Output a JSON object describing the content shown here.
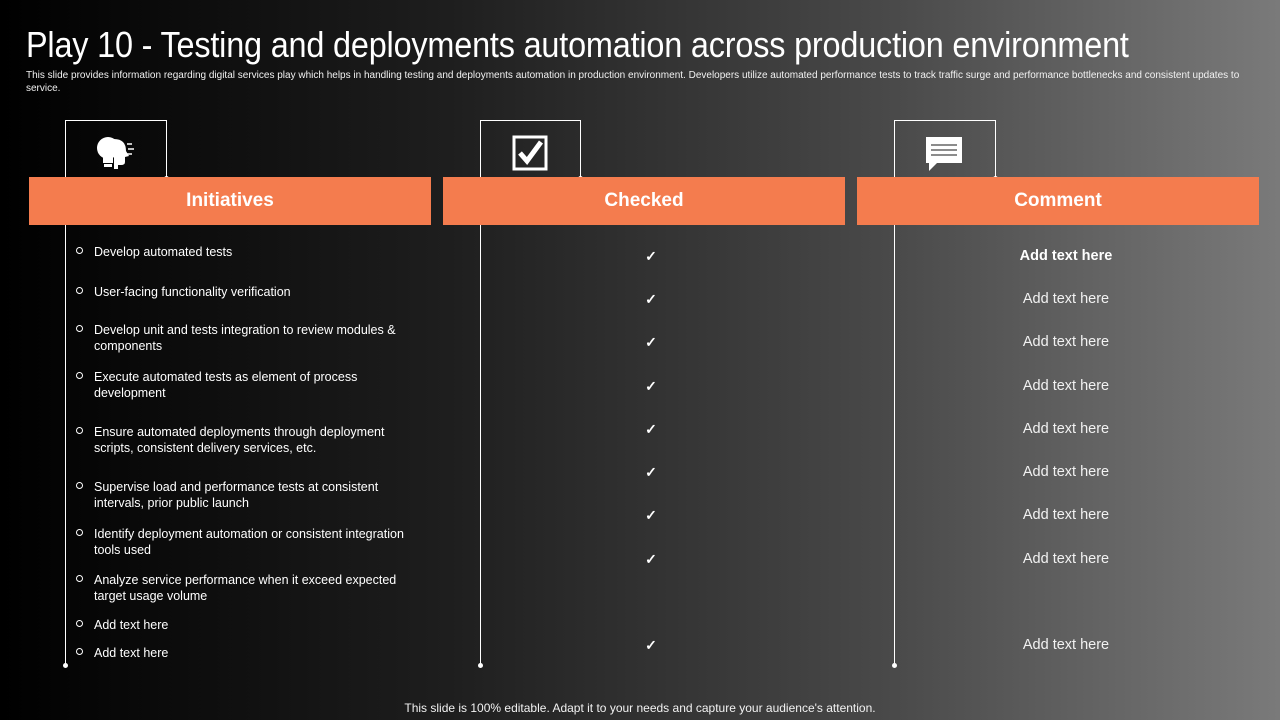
{
  "slide": {
    "title": "Play 10 - Testing and deployments automation across production environment",
    "subtitle": "This slide provides information regarding digital services play which helps in handling testing and deployments automation in production environment. Developers utilize automated performance tests to track traffic surge and performance bottlenecks and consistent updates to service.",
    "footer": "This slide is 100% editable. Adapt it to your needs and capture your audience's attention."
  },
  "columns": [
    {
      "label": "Initiatives",
      "icon": "lightbulb-head-icon"
    },
    {
      "label": "Checked",
      "icon": "checkbox-icon"
    },
    {
      "label": "Comment",
      "icon": "speech-bubble-icon"
    }
  ],
  "colors": {
    "accent": "#f47c4e",
    "background_dark": "#000000",
    "background_light": "#7a7a7a"
  },
  "initiatives": [
    "Develop  automated tests",
    "User-facing  functionality verification",
    "Develop  unit and tests integration to review  modules & components",
    "Execute automated tests as element of process development",
    "Ensure automated deployments through deployment scripts, consistent delivery  services, etc.",
    "Supervise  load and performance  tests at consistent intervals,  prior public launch",
    "Identify deployment automation or consistent integration tools used",
    "Analyze service performance  when it exceed expected target usage volume",
    "Add text here",
    "Add text here"
  ],
  "checks": [
    "✓",
    "✓",
    "✓",
    "✓",
    "✓",
    "✓",
    "✓",
    "✓",
    "✓"
  ],
  "comments": [
    "Add  text here",
    "Add text here",
    "Add text here",
    "Add text here",
    "Add text here",
    "Add text here",
    "Add text here",
    "Add text here",
    "Add text here"
  ]
}
